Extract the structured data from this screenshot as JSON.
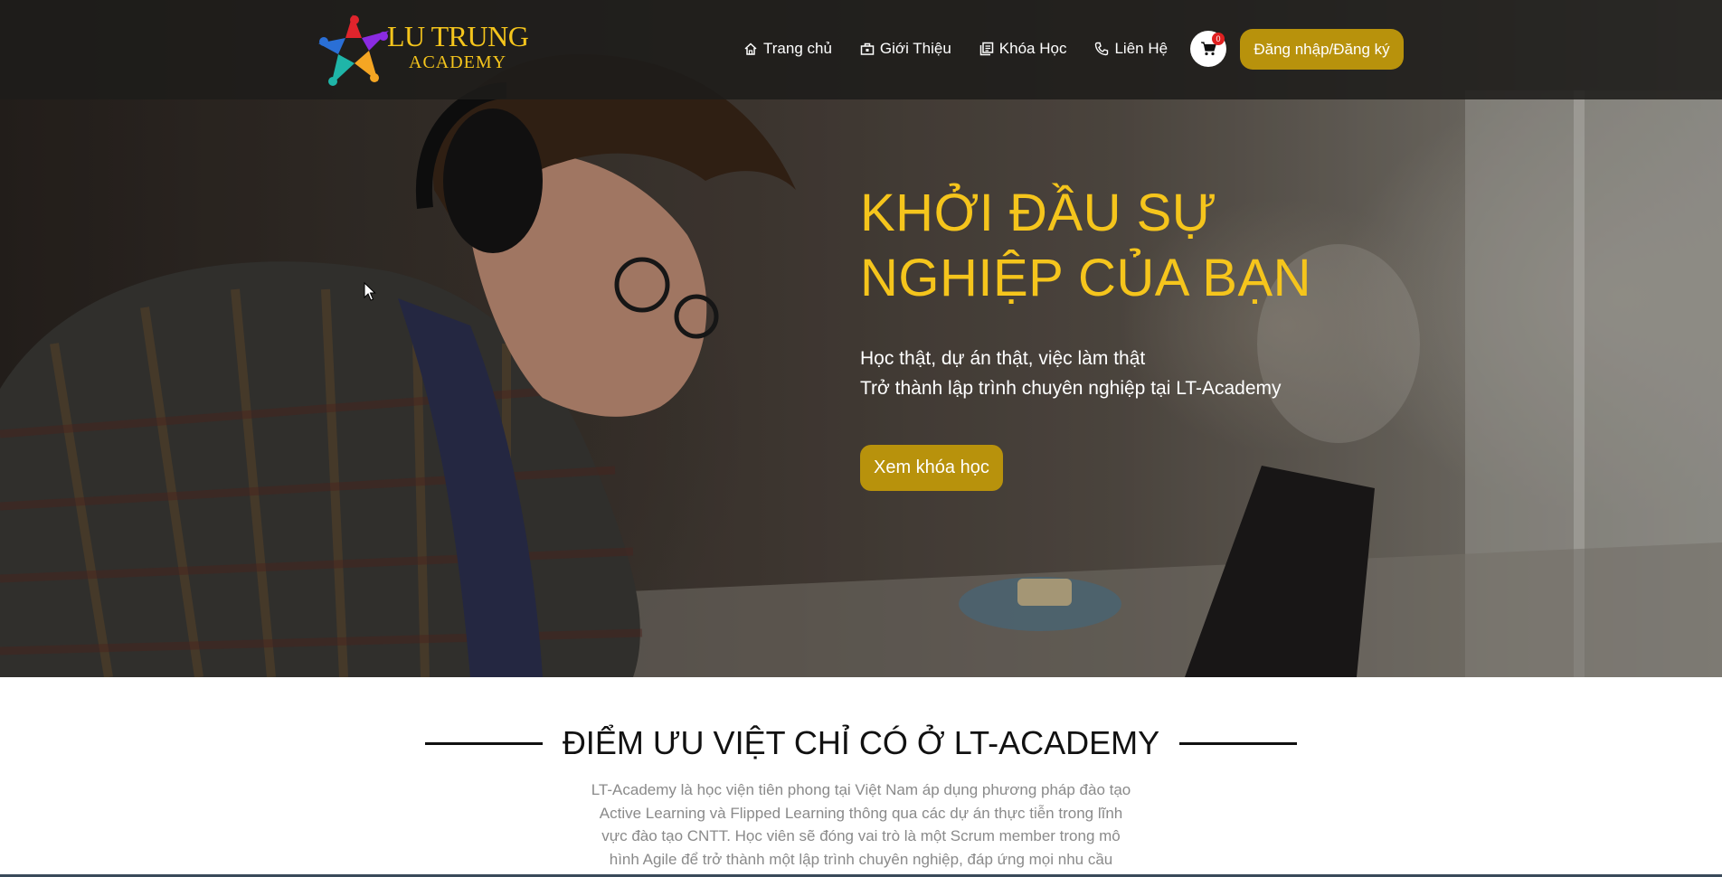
{
  "brand": {
    "name_line1": "LU TRUNG",
    "name_line2": "ACADEMY",
    "colors": {
      "gold": "#f5c51c",
      "button": "#b8920c"
    }
  },
  "nav": {
    "items": [
      {
        "label": "Trang chủ",
        "icon": "home-icon"
      },
      {
        "label": "Giới Thiệu",
        "icon": "briefcase-icon"
      },
      {
        "label": "Khóa Học",
        "icon": "library-icon"
      },
      {
        "label": "Liên Hệ",
        "icon": "phone-icon"
      }
    ],
    "cart_count": "0",
    "login_label": "Đăng nhập/Đăng ký"
  },
  "hero": {
    "title_line1": "KHỞI ĐẦU SỰ",
    "title_line2": "NGHIỆP CỦA BẠN",
    "subtitle_line1": "Học thật, dự án thật, việc làm thật",
    "subtitle_line2": "Trở thành lập trình chuyên nghiệp tại LT-Academy",
    "cta_label": "Xem khóa học"
  },
  "features": {
    "title": "ĐIỂM ƯU VIỆT CHỈ CÓ Ở LT-ACADEMY",
    "desc_line1": "LT-Academy là học viện tiên phong tại Việt Nam áp dụng phương pháp đào tạo",
    "desc_line2": "Active Learning và Flipped Learning thông qua các dự án thực tiễn trong lĩnh",
    "desc_line3": "vực đào tạo CNTT. Học viên sẽ đóng vai trò là một Scrum member trong mô",
    "desc_line4": "hình Agile để trở thành một lập trình chuyên nghiệp, đáp ứng mọi nhu cầu"
  }
}
